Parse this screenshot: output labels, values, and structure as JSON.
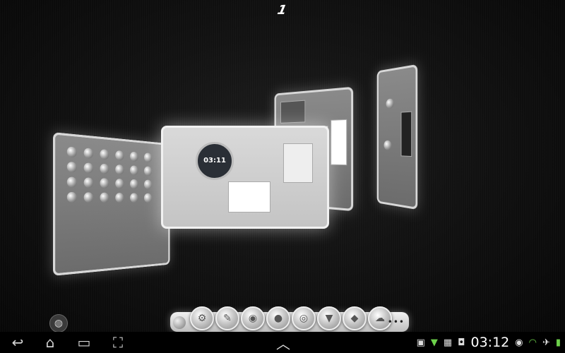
{
  "home": {
    "page_number": "1",
    "clock_widget_time": "03:11"
  },
  "dock": {
    "apps": [
      {
        "icon": "settings-icon",
        "glyph": "⚙"
      },
      {
        "icon": "note-icon",
        "glyph": "✎"
      },
      {
        "icon": "camera-icon",
        "glyph": "◉"
      },
      {
        "icon": "globe-icon",
        "glyph": "●"
      },
      {
        "icon": "chrome-icon",
        "glyph": "◎"
      },
      {
        "icon": "app-icon",
        "glyph": "▼"
      },
      {
        "icon": "maps-icon",
        "glyph": "◆"
      },
      {
        "icon": "cloud-icon",
        "glyph": "☁"
      }
    ],
    "more": "•••"
  },
  "navbar": {
    "back_glyph": "↩",
    "home_glyph": "⌂",
    "recents_glyph": "▭",
    "screenshot_glyph": "⛶",
    "up_glyph": "︿"
  },
  "status": {
    "time": "03:12"
  }
}
